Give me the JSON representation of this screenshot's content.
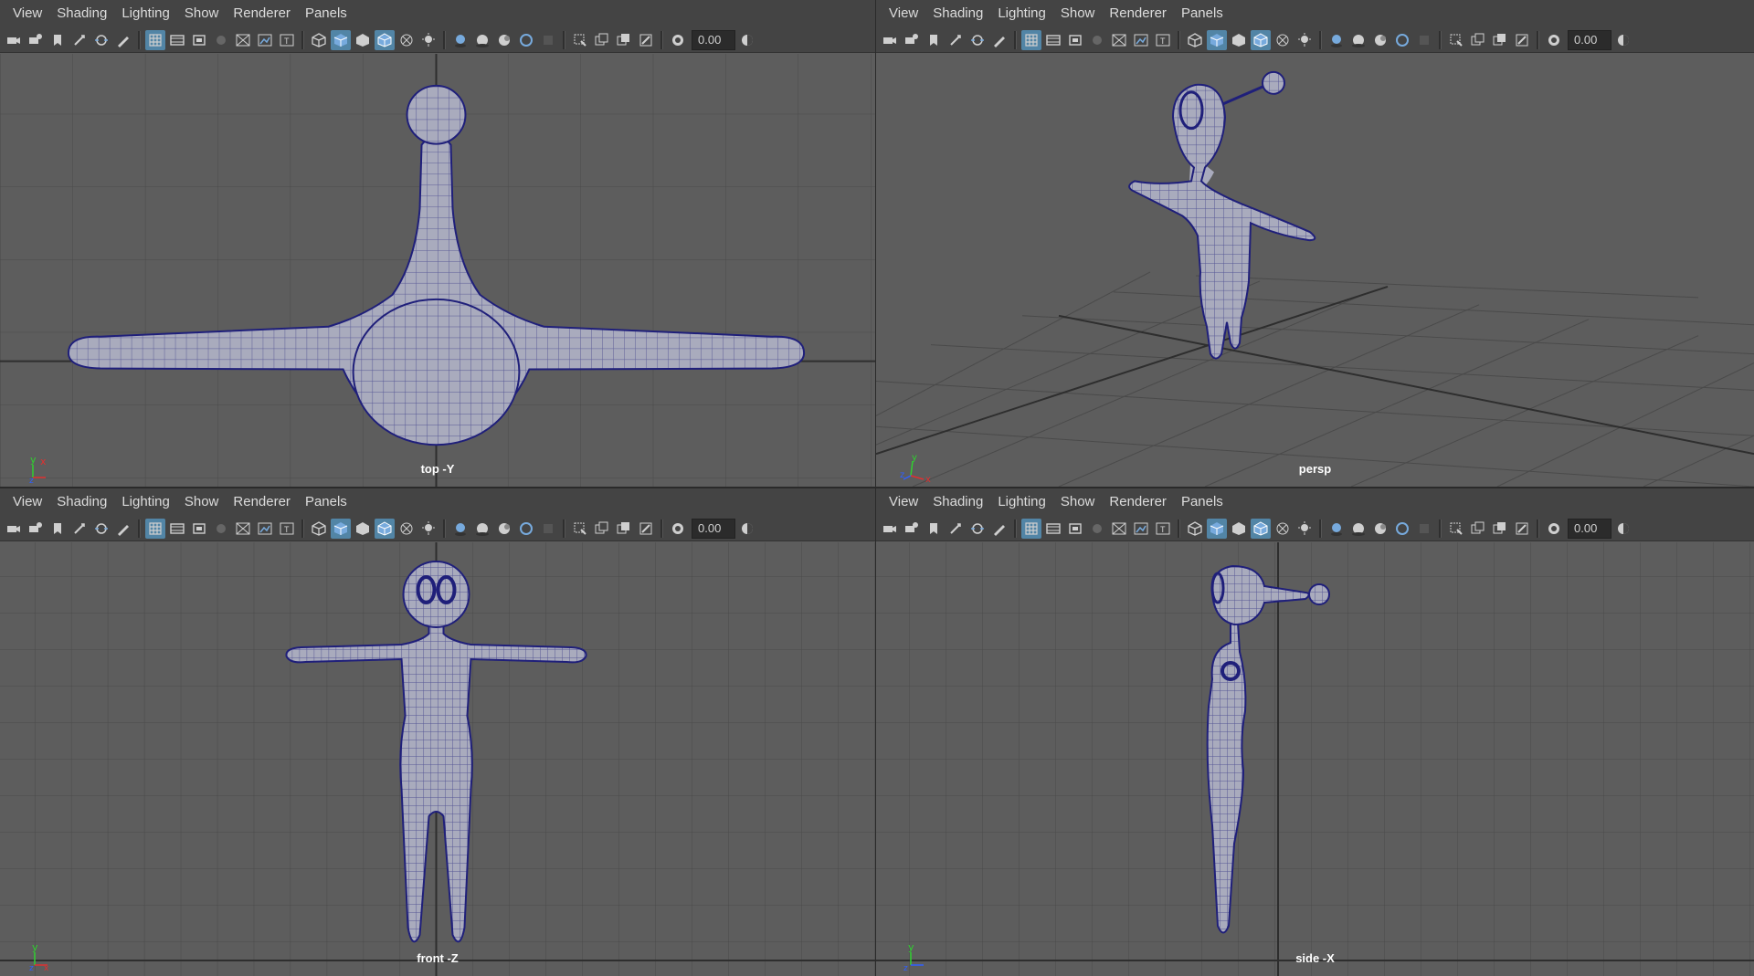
{
  "menus": [
    "View",
    "Shading",
    "Lighting",
    "Show",
    "Renderer",
    "Panels"
  ],
  "toolbar": {
    "field_value": "0.00",
    "icons": [
      "camera-icon",
      "camera-attributes-icon",
      "bookmark-icon",
      "image-plane-icon",
      "2d-pan-zoom-icon",
      "grease-pencil-icon",
      "grid-icon",
      "film-gate-icon",
      "resolution-gate-icon",
      "gate-mask-icon",
      "field-chart-icon",
      "safe-action-icon",
      "safe-title-icon",
      "wireframe-icon",
      "smooth-shade-icon",
      "default-material-icon",
      "wireframe-on-shaded-icon",
      "xray-icon",
      "use-lights-icon",
      "shadows-icon",
      "screen-space-ao-icon",
      "motion-blur-icon",
      "anti-alias-icon",
      "depth-of-field-icon",
      "isolate-select-icon",
      "xray-joints-icon",
      "xray-active-icon",
      "backface-icon",
      "exposure-icon",
      "gamma-icon"
    ],
    "accent": "#5285a6"
  },
  "panels": [
    {
      "id": "top",
      "camera": "top -Y",
      "axis": [
        "y",
        "x",
        "z"
      ]
    },
    {
      "id": "persp",
      "camera": "persp",
      "axis": [
        "y",
        "x",
        "z"
      ]
    },
    {
      "id": "front",
      "camera": "front -Z",
      "axis": [
        "y",
        "x",
        "z"
      ]
    },
    {
      "id": "side",
      "camera": "side -X",
      "axis": [
        "y",
        "z"
      ]
    }
  ],
  "colors": {
    "viewport_bg": "#5d5d5d",
    "grid": "#4a4a4a",
    "grid_axis": "#2e2e2e",
    "mesh_fill": "#a9abbd",
    "mesh_wire": "#1f1f7a",
    "axis_x": "#e03030",
    "axis_y": "#30d030",
    "axis_z": "#3060ff"
  }
}
